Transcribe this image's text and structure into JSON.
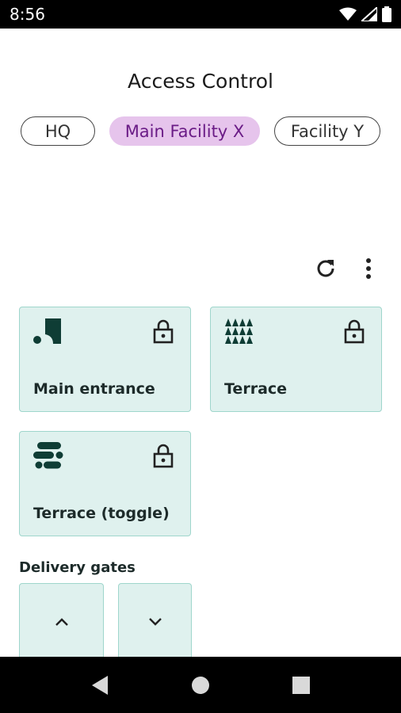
{
  "status_bar": {
    "time": "8:56",
    "icons": [
      "wifi-icon",
      "signal-icon",
      "battery-icon"
    ]
  },
  "header": {
    "title": "Access Control"
  },
  "facility_tabs": [
    {
      "label": "HQ",
      "selected": false
    },
    {
      "label": "Main Facility X",
      "selected": true
    },
    {
      "label": "Facility Y",
      "selected": false
    }
  ],
  "actions": {
    "refresh_icon": "refresh-icon",
    "more_icon": "more-vert-icon"
  },
  "doors": [
    {
      "label": "Main entrance",
      "icon": "shape-logo-icon",
      "lock_icon": "lock-icon"
    },
    {
      "label": "Terrace",
      "icon": "triangles-icon",
      "lock_icon": "lock-icon"
    },
    {
      "label": "Terrace (toggle)",
      "icon": "blobs-icon",
      "lock_icon": "lock-icon"
    }
  ],
  "delivery_gates": {
    "label": "Delivery gates",
    "up_icon": "chevron-up-icon",
    "down_icon": "chevron-down-icon"
  },
  "nav": {
    "back_icon": "back-icon",
    "home_icon": "home-icon",
    "recents_icon": "recents-icon"
  },
  "colors": {
    "card_bg": "#dff1ee",
    "card_border": "#9fd6cc",
    "chip_selected_bg": "#e6c4ec",
    "chip_selected_text": "#6a1b86",
    "icon_dark": "#0f3d35"
  }
}
